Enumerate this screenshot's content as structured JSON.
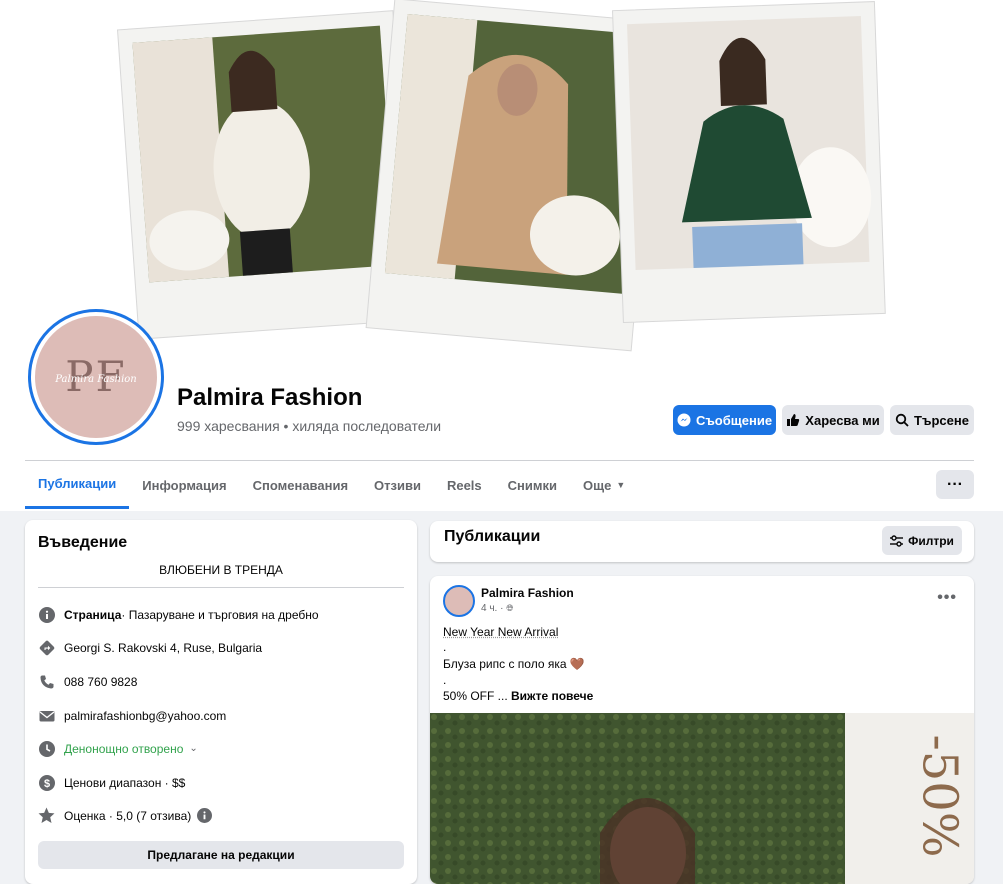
{
  "page": {
    "name": "Palmira Fashion",
    "stats": "999 харесвания • хиляда последователи",
    "avatar_monogram": "PF",
    "avatar_script": "Palmira Fashion"
  },
  "actions": {
    "message": "Съобщение",
    "like": "Харесва ми",
    "search": "Търсене",
    "more": "···"
  },
  "tabs": [
    {
      "label": "Публикации",
      "active": true
    },
    {
      "label": "Информация"
    },
    {
      "label": "Споменавания"
    },
    {
      "label": "Отзиви"
    },
    {
      "label": "Reels"
    },
    {
      "label": "Снимки"
    },
    {
      "label": "Още"
    }
  ],
  "intro": {
    "title": "Въведение",
    "bio": "ВЛЮБЕНИ В ТРЕНДА",
    "category_bold": "Страница",
    "category_rest": " · Пазаруване и търговия на дребно",
    "address": "Georgi S. Rakovski 4, Ruse, Bulgaria",
    "phone": "088 760 9828",
    "email": "palmirafashionbg@yahoo.com",
    "hours": "Денонощно отворено",
    "price": "Ценови диапазон · $$",
    "rating": "Оценка · 5,0 (7 отзива)",
    "suggest": "Предлагане на редакции"
  },
  "posts": {
    "title": "Публикации",
    "filters": "Филтри",
    "post": {
      "author": "Palmira Fashion",
      "time": "4 ч. ·",
      "line1": "New Year New Arrival",
      "dot1": ".",
      "line2": "Блуза рипс с поло яка 🤎",
      "dot2": ".",
      "line3": "50% OFF ... ",
      "see_more": "Вижте повече",
      "image_text": "-50%"
    }
  },
  "colors": {
    "accent": "#1b74e4",
    "green": "#31a24c",
    "avatar_bg": "#ddbcb7"
  }
}
